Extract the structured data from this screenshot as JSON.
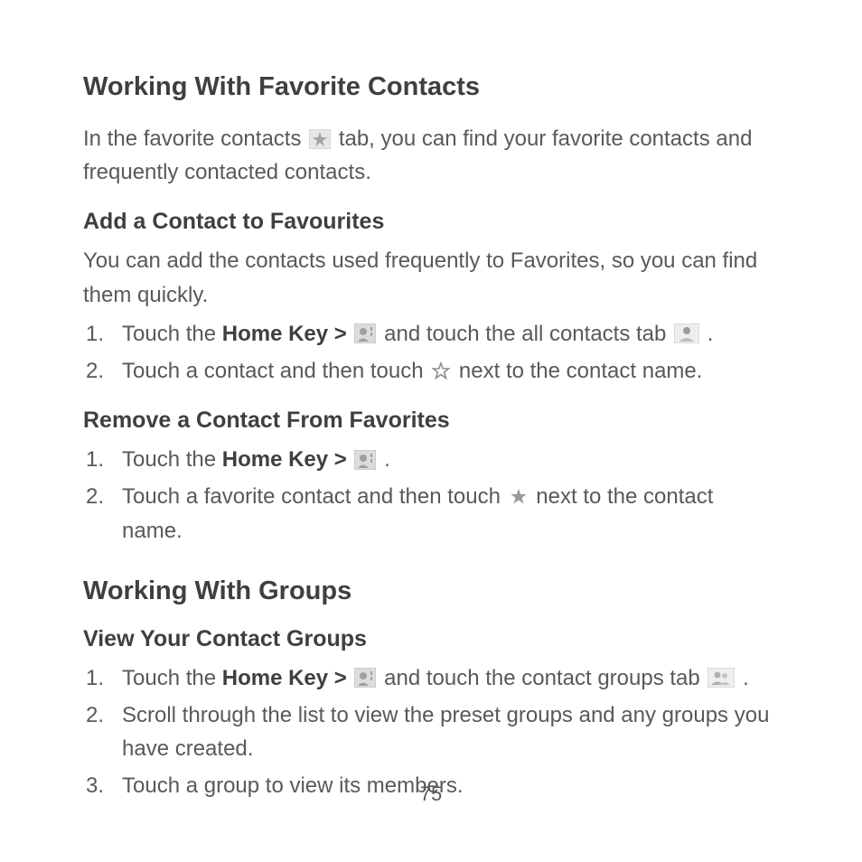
{
  "page_number": "75",
  "section1": {
    "title": "Working With Favorite Contacts",
    "intro_a": "In the favorite contacts ",
    "intro_b": " tab, you can find your favorite contacts and frequently contacted contacts.",
    "sub1": {
      "title": "Add a Contact to Favourites",
      "intro": "You can add the contacts used frequently to Favorites, so you can find them quickly.",
      "steps": [
        {
          "n": "1.",
          "a": "Touch the ",
          "bold": "Home Key > ",
          "b": " and touch the all contacts tab ",
          "c": " ."
        },
        {
          "n": "2.",
          "a": "Touch a contact and then touch ",
          "b": " next to the contact name."
        }
      ]
    },
    "sub2": {
      "title": "Remove a Contact From Favorites",
      "steps": [
        {
          "n": "1.",
          "a": "Touch the ",
          "bold": "Home Key > ",
          "b": " ."
        },
        {
          "n": "2.",
          "a": "Touch a favorite contact and then touch ",
          "b": " next to the contact name."
        }
      ]
    }
  },
  "section2": {
    "title": "Working With Groups",
    "sub1": {
      "title": "View Your Contact Groups",
      "steps": [
        {
          "n": "1.",
          "a": "Touch the ",
          "bold": "Home Key > ",
          "b": " and touch the contact groups tab ",
          "c": " ."
        },
        {
          "n": "2.",
          "a": "Scroll through the list to view the preset groups and any groups you have created."
        },
        {
          "n": "3.",
          "a": "Touch a group to view its members."
        }
      ]
    }
  }
}
